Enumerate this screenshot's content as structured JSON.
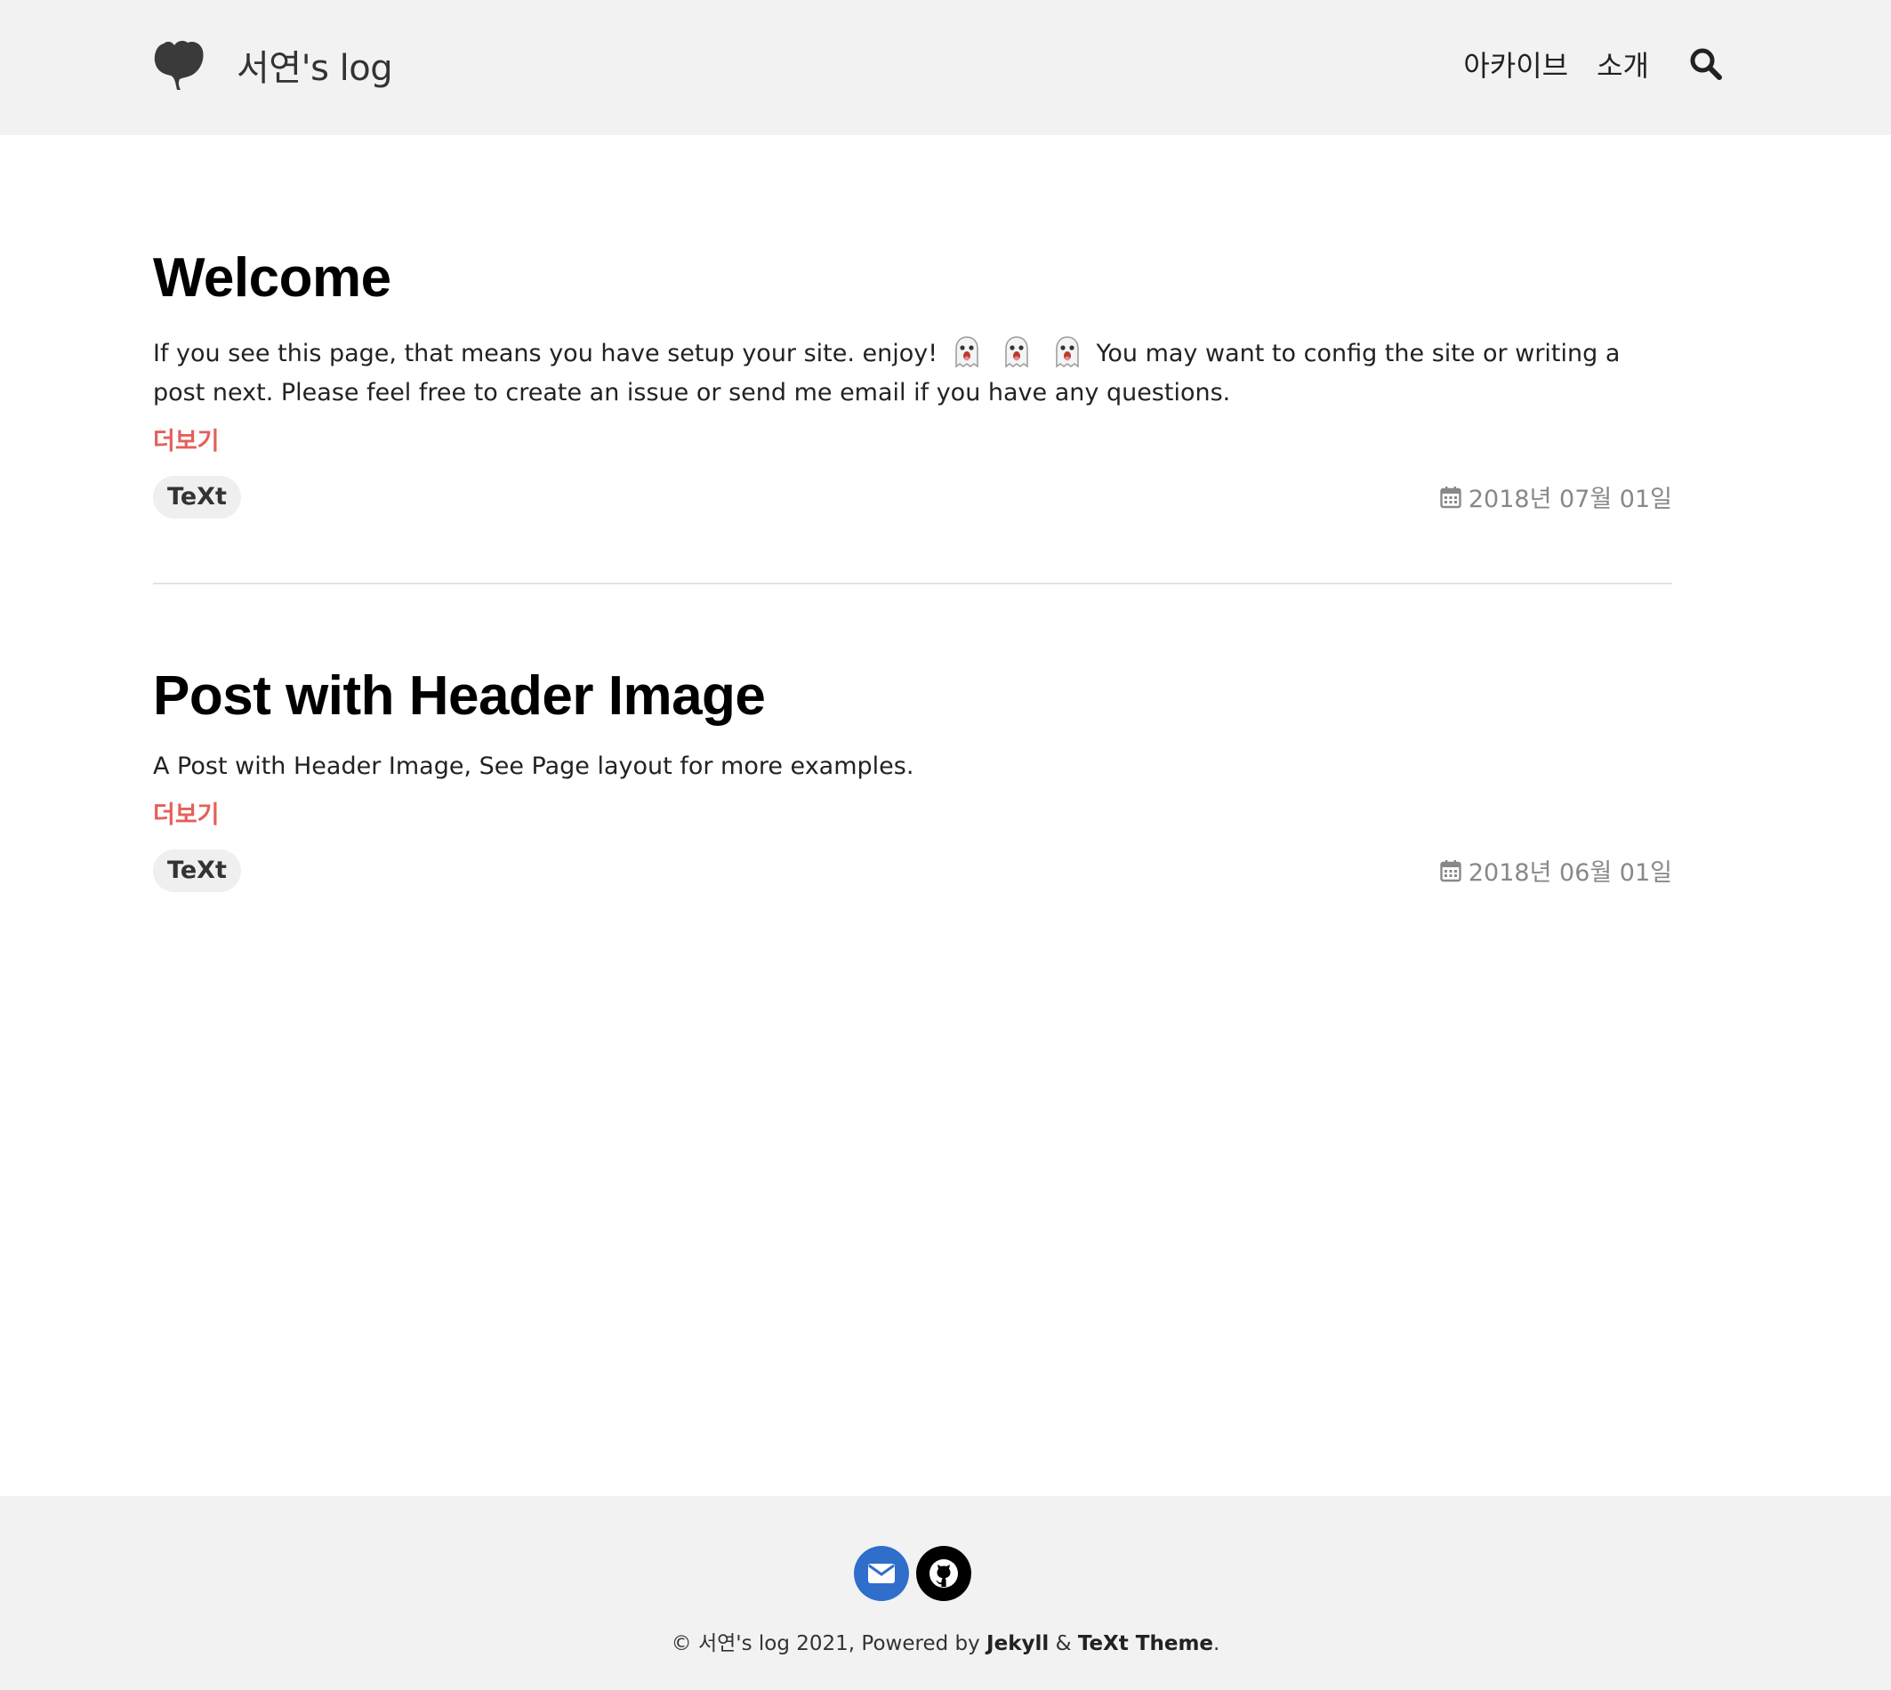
{
  "header": {
    "site_title": "서연's log",
    "nav": [
      {
        "label": "아카이브"
      },
      {
        "label": "소개"
      }
    ],
    "logo_icon": "ginkgo-leaf-icon",
    "search_icon": "search-icon"
  },
  "posts": [
    {
      "title": "Welcome",
      "excerpt_before": "If you see this page, that means you have setup your site. enjoy!",
      "excerpt_emoji": "👻 👻 👻",
      "excerpt_after": "You may want to config the site or writing a post next. Please feel free to create an issue or send me email if you have any questions.",
      "more_label": "더보기",
      "tag": "TeXt",
      "date": "2018년 07월 01일"
    },
    {
      "title": "Post with Header Image",
      "excerpt": "A Post with Header Image, See Page layout for more examples.",
      "more_label": "더보기",
      "tag": "TeXt",
      "date": "2018년 06월 01일"
    }
  ],
  "footer": {
    "social": [
      {
        "name": "mail",
        "icon": "envelope-icon",
        "color": "#2f6ecb"
      },
      {
        "name": "github",
        "icon": "github-icon",
        "color": "#000000"
      }
    ],
    "copyright_prefix": "© 서연's log 2021, Powered by",
    "jekyll": "Jekyll",
    "amp": "&",
    "theme": "TeXt Theme",
    "period": "."
  },
  "colors": {
    "accent": "#e55f5b",
    "header_bg": "#f2f2f2",
    "tag_bg": "#efefef",
    "date_text": "#888888"
  }
}
